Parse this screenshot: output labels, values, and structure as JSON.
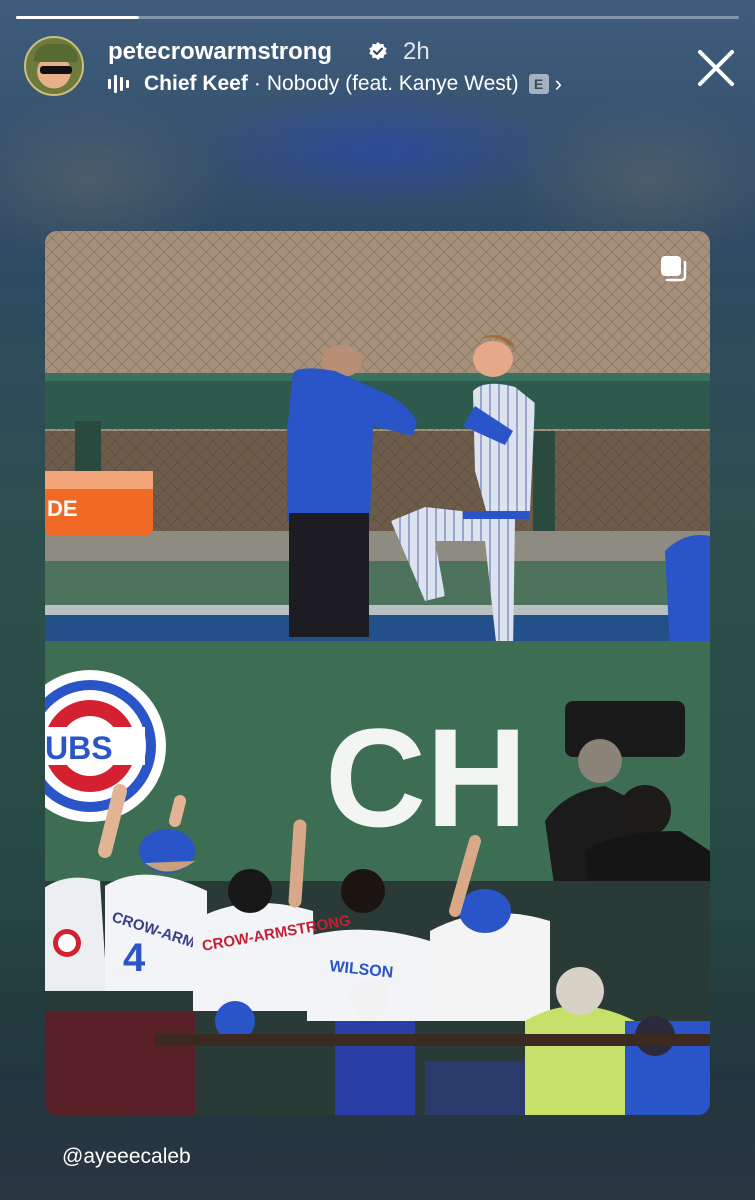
{
  "story": {
    "progress": 0.17,
    "username": "petecrowarmstrong",
    "time_ago": "2h",
    "music": {
      "artist": "Chief Keef",
      "separator": "·",
      "song": "Nobody (feat. Kanye West)",
      "explicit_badge": "E"
    },
    "icons": [
      "verified-icon",
      "music-equalizer-icon",
      "chevron-right-icon",
      "close-icon",
      "multi-photo-icon"
    ],
    "mention": "@ayeeecaleb"
  },
  "photo": {
    "sign_logo_text": "UBS",
    "banner_text": "CH",
    "jerseys": [
      {
        "number": "4",
        "name": "CROW-ARMSTRONG"
      },
      {
        "name": "CROW-ARMSTRONG"
      },
      {
        "name": "WILSON"
      }
    ],
    "cooler_text": "DE",
    "colors": {
      "cubs_blue": "#2a55c8",
      "cubs_red": "#d42030",
      "wall_green": "#3d6d52"
    }
  }
}
